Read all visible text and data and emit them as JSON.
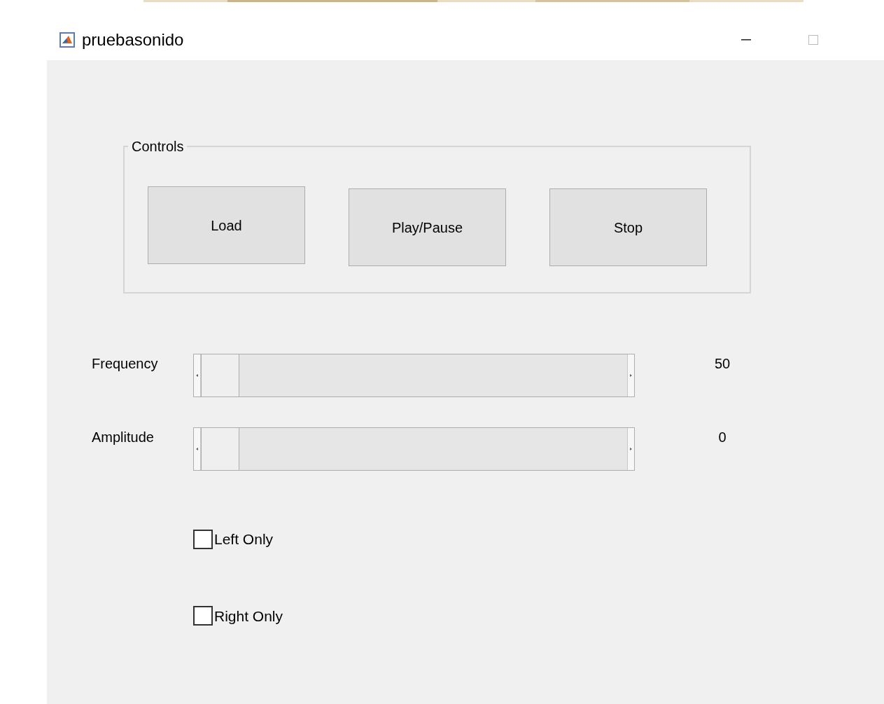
{
  "window": {
    "title": "pruebasonido"
  },
  "controls": {
    "title": "Controls",
    "buttons": [
      "Load",
      "Play/Pause",
      "Stop"
    ]
  },
  "sliders": [
    {
      "label": "Frequency",
      "level": 0,
      "reading": "50"
    },
    {
      "label": "Amplitude",
      "level": 0,
      "reading": "0"
    }
  ],
  "checkboxes": [
    {
      "label": "Left Only",
      "checked": false
    },
    {
      "label": "Right Only",
      "checked": false
    }
  ]
}
